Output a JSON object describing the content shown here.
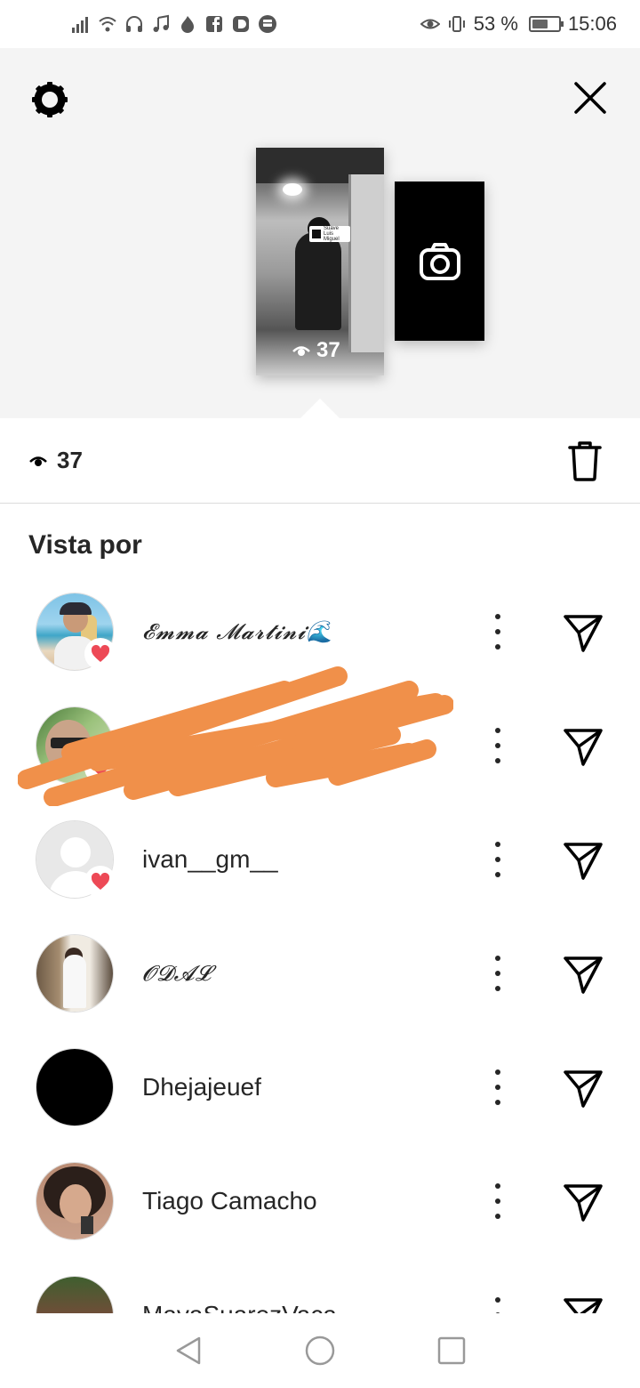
{
  "status_bar": {
    "battery": "53 %",
    "time": "15:06",
    "icons": [
      "signal-icon",
      "wifi-icon",
      "headphones-icon",
      "music-note-icon",
      "flame-icon",
      "facebook-icon",
      "d-app-icon",
      "bus-icon",
      "eye-icon",
      "vibrate-icon",
      "battery-icon"
    ]
  },
  "story": {
    "view_count": "37",
    "music_sticker": {
      "title": "Suave",
      "artist": "Luis Miguel"
    }
  },
  "stats": {
    "views": "37"
  },
  "section_title": "Vista por",
  "viewers": [
    {
      "name": "𝓔𝓶𝓶𝓪 𝓜𝓪𝓻𝓽𝓲𝓷𝓲🌊",
      "liked": true
    },
    {
      "name": "…",
      "liked": true
    },
    {
      "name": "ivan__gm__",
      "liked": true
    },
    {
      "name": "𝓞𝓓𝓐𝓛",
      "liked": false
    },
    {
      "name": "Dhejajeuef",
      "liked": false
    },
    {
      "name": "Tiago Camacho",
      "liked": false
    },
    {
      "name": "MayaSuarezVaca",
      "liked": false
    }
  ],
  "colors": {
    "heart": "#ed4956",
    "text": "#262626",
    "scribble": "#f0904a",
    "top_bg": "#f4f4f4"
  }
}
